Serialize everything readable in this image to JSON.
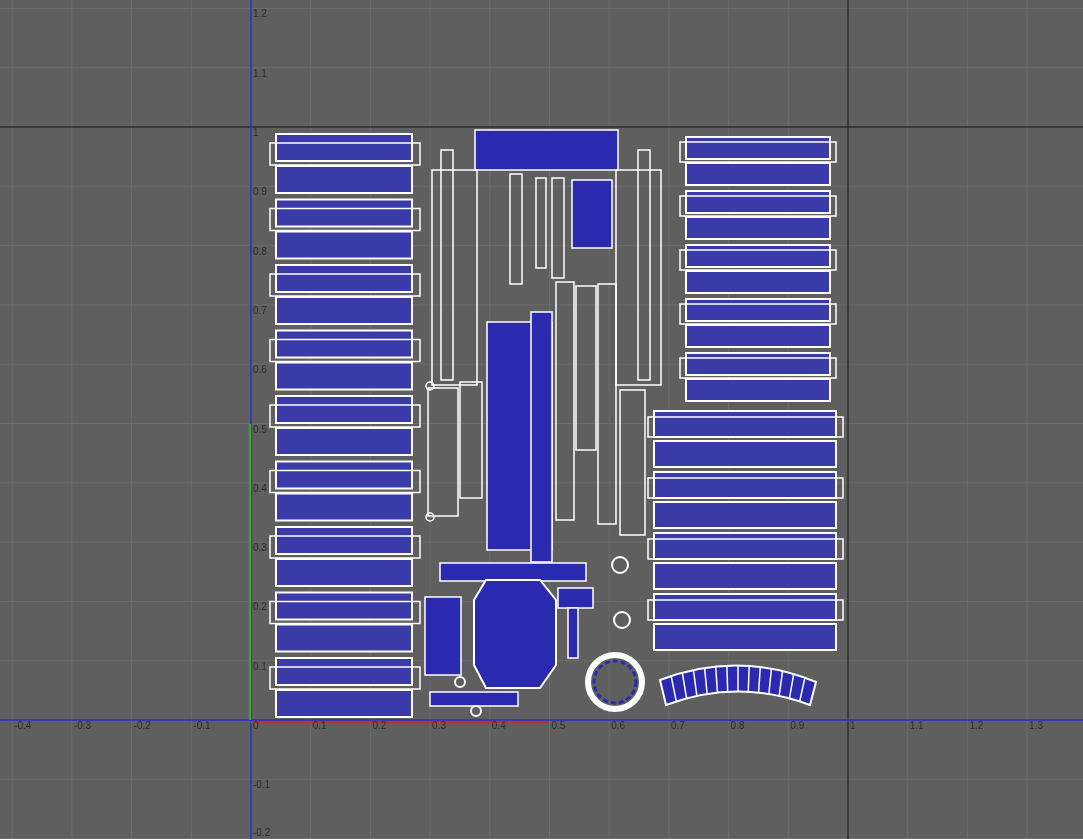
{
  "uv_editor": {
    "x_labels": [
      "-0.4",
      "-0.3",
      "-0.2",
      "-0.1",
      "0",
      "0.1",
      "0.2",
      "0.3",
      "0.4",
      "0.5",
      "0.6",
      "0.7",
      "0.8",
      "0.9",
      "1",
      "1.1",
      "1.2",
      "1.3"
    ],
    "y_labels": [
      "1.2",
      "1.1",
      "1",
      "0.9",
      "0.8",
      "0.7",
      "0.6",
      "0.5",
      "0.4",
      "0.3",
      "0.2",
      "0.1",
      "-0.1",
      "-0.2"
    ]
  }
}
